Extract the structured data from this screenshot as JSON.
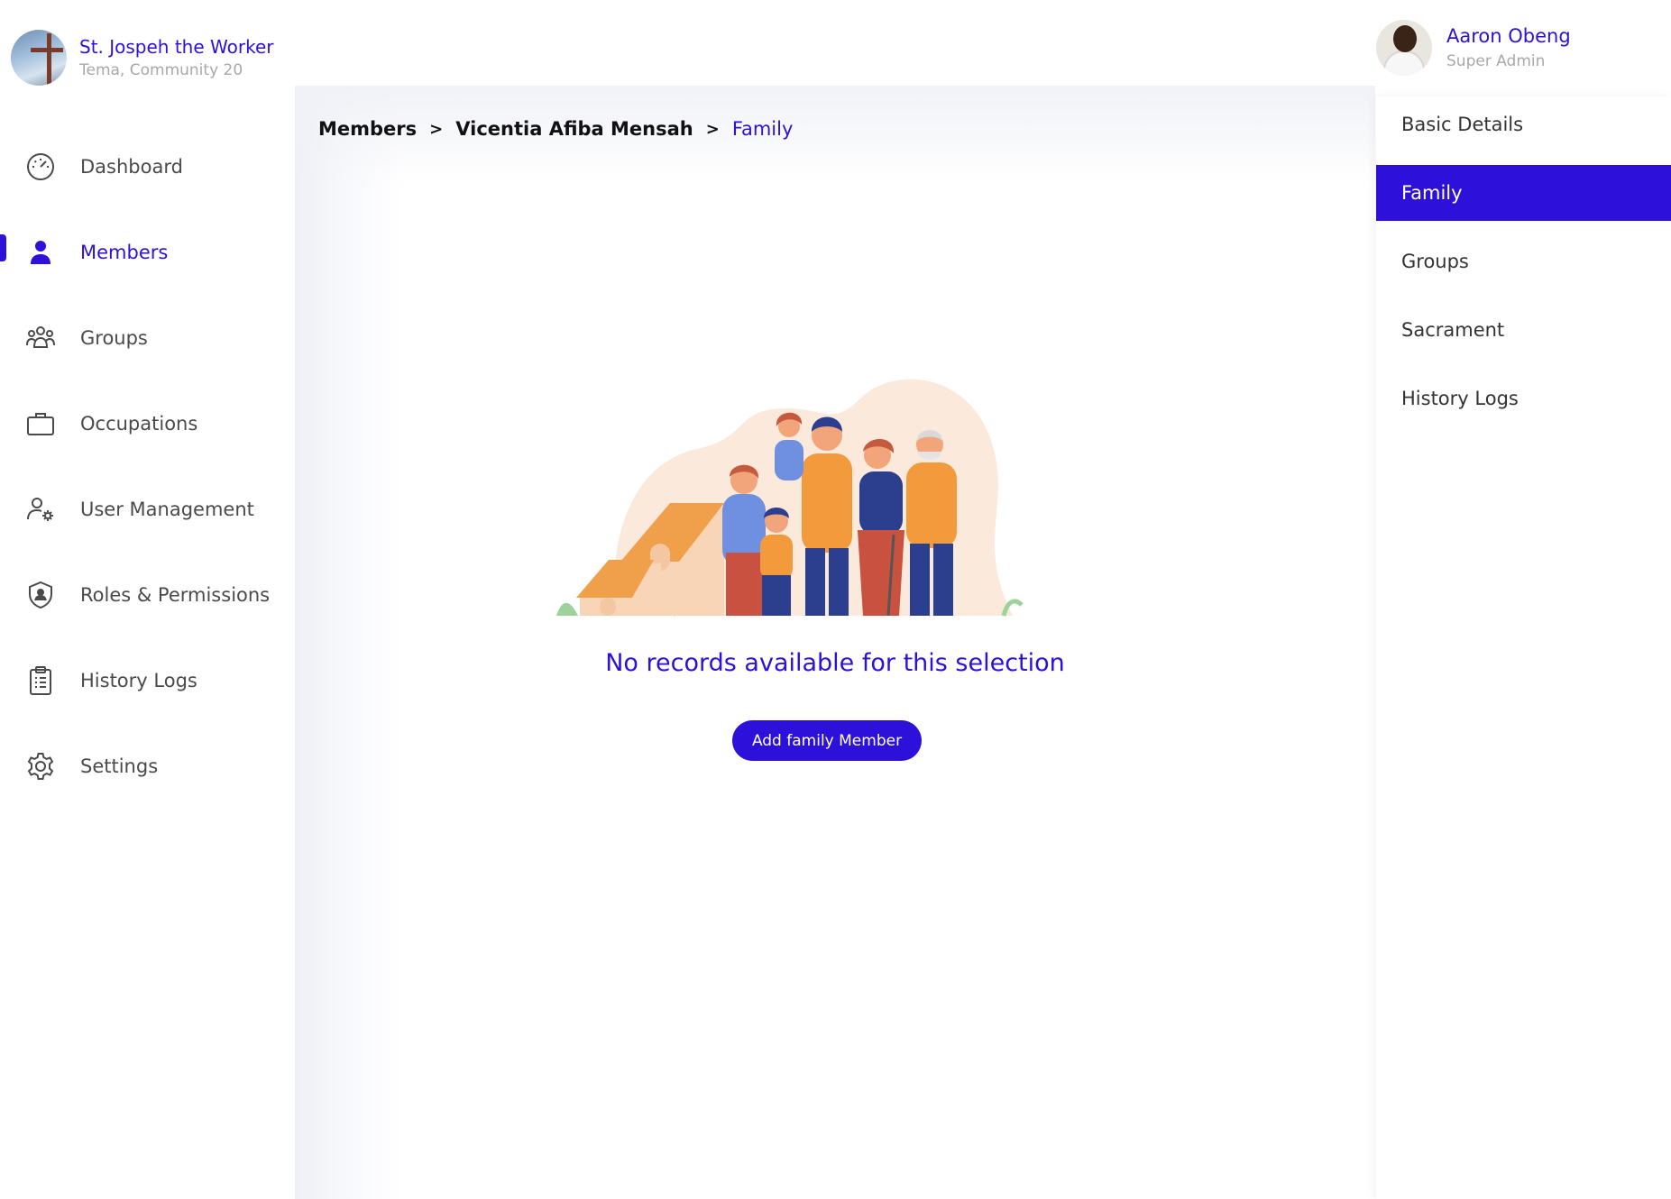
{
  "brand": {
    "name": "St. Jospeh the Worker",
    "location": "Tema, Community 20"
  },
  "nav": {
    "items": [
      {
        "label": "Dashboard",
        "icon": "speedometer-icon"
      },
      {
        "label": "Members",
        "icon": "person-icon",
        "active": true
      },
      {
        "label": "Groups",
        "icon": "group-icon"
      },
      {
        "label": "Occupations",
        "icon": "briefcase-icon"
      },
      {
        "label": "User Management",
        "icon": "user-gear-icon"
      },
      {
        "label": "Roles & Permissions",
        "icon": "shield-user-icon"
      },
      {
        "label": "History Logs",
        "icon": "clipboard-list-icon"
      },
      {
        "label": "Settings",
        "icon": "gear-icon"
      }
    ]
  },
  "user": {
    "name": "Aaron Obeng",
    "role": "Super Admin"
  },
  "breadcrumb": {
    "items": [
      "Members",
      "Vicentia Afiba Mensah"
    ],
    "current": "Family",
    "separator": ">"
  },
  "empty_state": {
    "message": "No records available for this selection",
    "button_label": "Add family Member",
    "illustration": "family-illustration"
  },
  "detail_tabs": {
    "items": [
      {
        "label": "Basic Details"
      },
      {
        "label": "Family",
        "active": true
      },
      {
        "label": "Groups"
      },
      {
        "label": "Sacrament"
      },
      {
        "label": "History Logs"
      }
    ]
  },
  "colors": {
    "accent": "#2d10d9",
    "muted_text": "#a8a8a8",
    "body_text": "#4a4a4a"
  }
}
